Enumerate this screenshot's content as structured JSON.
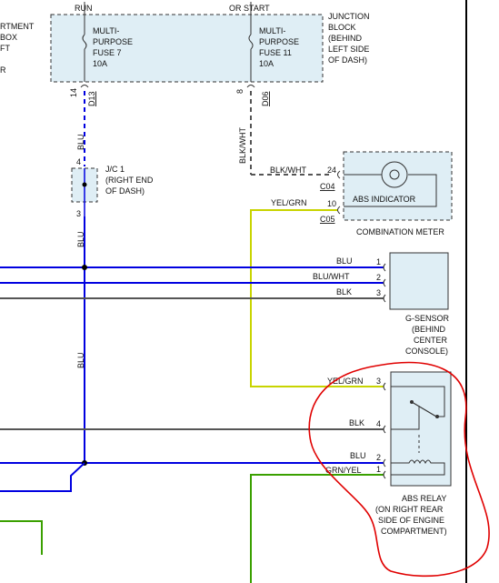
{
  "colors": {
    "blue_wire": "#0000e0",
    "blk_wire": "#555555",
    "yel_grn_wire": "#c8d400",
    "grn_wire": "#3aa000",
    "highlight": "#e00000",
    "box_fill": "#dfeef5"
  },
  "left_cut_text": [
    "RTMENT",
    "BOX",
    "FT",
    "R"
  ],
  "junction_block": {
    "run_label": "RUN",
    "start_label": "OR START",
    "fuse7": [
      "MULTI-",
      "PURPOSE",
      "FUSE 7",
      "10A"
    ],
    "fuse11": [
      "MULTI-",
      "PURPOSE",
      "FUSE 11",
      "10A"
    ],
    "title": [
      "JUNCTION",
      "BLOCK",
      "(BEHIND",
      "LEFT SIDE",
      "OF DASH)"
    ],
    "pin_14": "14",
    "conn_d13": "D13",
    "pin_8": "8",
    "conn_d06": "D06"
  },
  "wires": {
    "blu": "BLU",
    "blk_wht": "BLK/WHT",
    "yel_grn": "YEL/GRN",
    "blu_wht": "BLU/WHT",
    "blk": "BLK",
    "grn_yel": "GRN/YEL"
  },
  "jc1": {
    "pin_top": "4",
    "pin_bottom": "3",
    "label": [
      "J/C 1",
      "(RIGHT END",
      "OF DASH)"
    ]
  },
  "combination_meter": {
    "pin_24": "24",
    "conn_c04": "C04",
    "pin_10": "10",
    "conn_c05": "C05",
    "indicator": "ABS INDICATOR",
    "title": "COMBINATION METER"
  },
  "g_sensor": {
    "pins": [
      "1",
      "2",
      "3"
    ],
    "title": [
      "G-SENSOR",
      "(BEHIND",
      "CENTER",
      "CONSOLE)"
    ]
  },
  "abs_relay": {
    "pins": [
      "3",
      "4",
      "2",
      "1"
    ],
    "title": [
      "ABS RELAY",
      "(ON RIGHT REAR",
      "SIDE OF ENGINE",
      "COMPARTMENT)"
    ]
  }
}
